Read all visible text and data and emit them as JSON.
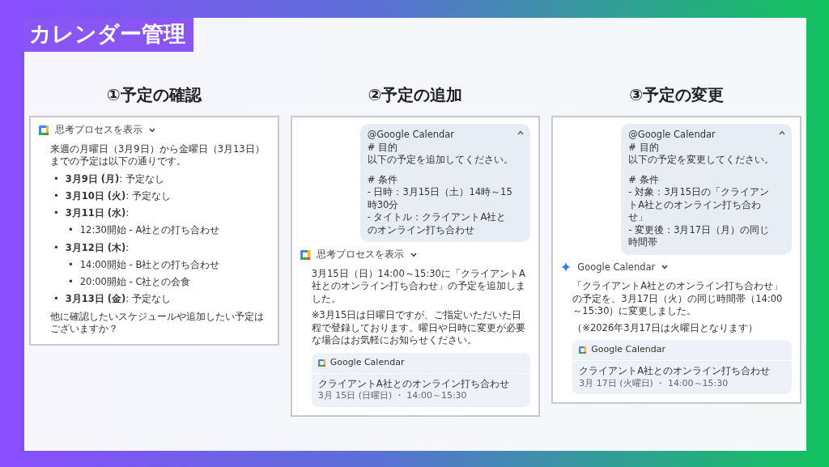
{
  "title": "カレンダー管理",
  "sections": [
    {
      "heading": "①予定の確認",
      "messages": [
        {
          "kind": "response",
          "header": {
            "kind": "thoughts",
            "label": "思考プロセスを表示"
          },
          "blocks": [
            {
              "kind": "paragraph",
              "text": "来週の月曜日（3月9日）から金曜日（3月13日）までの予定は以下の通りです。"
            },
            {
              "kind": "bullets",
              "marker": "•",
              "items": [
                {
                  "text": "**3月9日 (月)**: 予定なし"
                },
                {
                  "text": "**3月10日 (火)**: 予定なし"
                },
                {
                  "text": "**3月11日 (水)**:",
                  "children": [
                    {
                      "text": "12:30開始 - A社との打ち合わせ"
                    }
                  ]
                },
                {
                  "text": "**3月12日 (木)**:",
                  "children": [
                    {
                      "text": "14:00開始 - B社との打ち合わせ"
                    },
                    {
                      "text": "20:00開始 - C社との会食"
                    }
                  ]
                },
                {
                  "text": "**3月13日 (金)**: 予定なし"
                }
              ]
            },
            {
              "kind": "paragraph",
              "text": "他に確認したいスケジュールや追加したい予定はございますか？"
            }
          ]
        }
      ]
    },
    {
      "heading": "②予定の追加",
      "messages": [
        {
          "kind": "prompt",
          "groups": [
            [
              "@Google Calendar",
              "# 目的",
              "以下の予定を追加してください。"
            ],
            [
              "# 条件",
              "- 日時：3月15日（土）14時～15時30分",
              "- タイトル：クライアントA社とのオンライン打ち合わせ"
            ]
          ]
        },
        {
          "kind": "response",
          "header": {
            "kind": "thoughts",
            "label": "思考プロセスを表示"
          },
          "blocks": [
            {
              "kind": "paragraph",
              "text": "3月15日（日）14:00～15:30に「クライアントA社とのオンライン打ち合わせ」の予定を追加しました。"
            },
            {
              "kind": "paragraph",
              "text": "※3月15日は日曜日ですが、ご指定いただいた日程で登録しております。曜日や日時に変更が必要な場合はお気軽にお知らせください。"
            },
            {
              "kind": "event_card",
              "app": "Google Calendar",
              "title": "クライアントA社とのオンライン打ち合わせ",
              "when": "3月 15日 (日曜日) ・ 14:00～15:30"
            }
          ]
        }
      ]
    },
    {
      "heading": "③予定の変更",
      "messages": [
        {
          "kind": "prompt",
          "groups": [
            [
              "@Google Calendar",
              "# 目的",
              "以下の予定を変更してください。"
            ],
            [
              "# 条件",
              "- 対象：3月15日の「クライアントA社とのオンライン打ち合わせ」",
              "- 変更後：3月17日（月）の同じ時間帯"
            ]
          ]
        },
        {
          "kind": "response",
          "header": {
            "kind": "assistant",
            "label": "Google Calendar"
          },
          "blocks": [
            {
              "kind": "paragraph",
              "text": "「クライアントA社とのオンライン打ち合わせ」の予定を、3月17日（火）の同じ時間帯（14:00～15:30）に変更しました。"
            },
            {
              "kind": "paragraph",
              "text": "（※2026年3月17日は火曜日となります）"
            },
            {
              "kind": "event_card",
              "app": "Google Calendar",
              "title": "クライアントA社とのオンライン打ち合わせ",
              "when": "3月 17日 (火曜日) ・ 14:00～15:30"
            }
          ]
        }
      ]
    }
  ]
}
